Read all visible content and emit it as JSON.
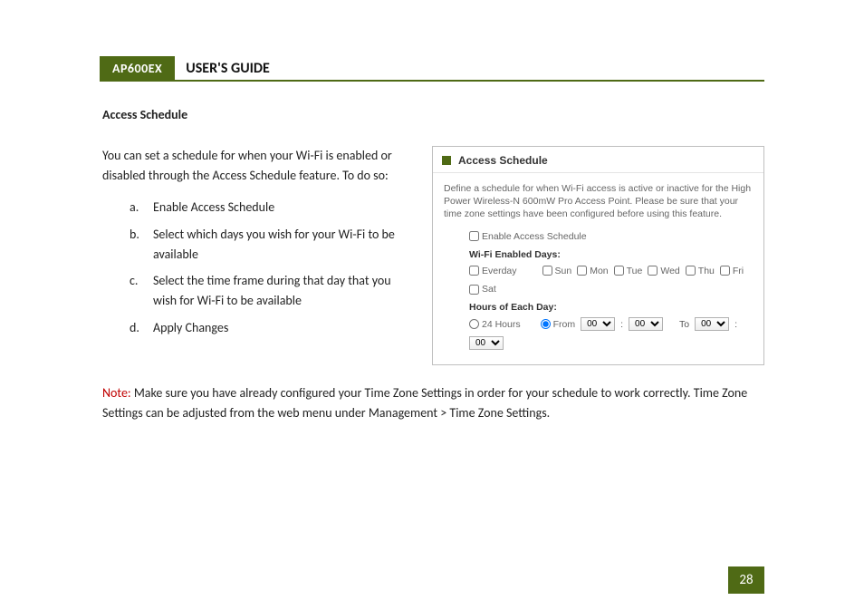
{
  "header": {
    "product": "AP600EX",
    "title": "USER'S GUIDE"
  },
  "section_title": "Access Schedule",
  "intro": "You can set a schedule for when your Wi-Fi is enabled or disabled through the Access Schedule feature.  To do so:",
  "steps": [
    {
      "marker": "a.",
      "text": "Enable Access Schedule"
    },
    {
      "marker": "b.",
      "text": "Select which days you wish for your Wi-Fi to be available"
    },
    {
      "marker": "c.",
      "text": "Select the time frame during that day that you wish for Wi-Fi to be available"
    },
    {
      "marker": "d.",
      "text": "Apply Changes"
    }
  ],
  "panel": {
    "title": "Access Schedule",
    "description": "Define a schedule for when Wi-Fi access is active or inactive for the High Power Wireless-N 600mW Pro Access Point. Please be sure that your time zone settings have been configured before using this feature.",
    "enable_label": "Enable Access Schedule",
    "days_heading": "Wi-Fi Enabled Days:",
    "everyday_label": "Everday",
    "days": [
      "Sun",
      "Mon",
      "Tue",
      "Wed",
      "Thu",
      "Fri",
      "Sat"
    ],
    "hours_heading": "Hours of Each Day:",
    "opt_24": "24 Hours",
    "opt_from": "From",
    "sep1": ":",
    "to_label": "To",
    "sep2": ":",
    "sel_hh1": "00",
    "sel_mm1": "00",
    "sel_hh2": "00",
    "sel_mm2": "00"
  },
  "note": {
    "label": "Note:",
    "text": "  Make sure you have already configured your Time Zone Settings in order for your schedule to work correctly.  Time Zone Settings can be adjusted from the web menu under Management > Time Zone Settings."
  },
  "page_number": "28"
}
